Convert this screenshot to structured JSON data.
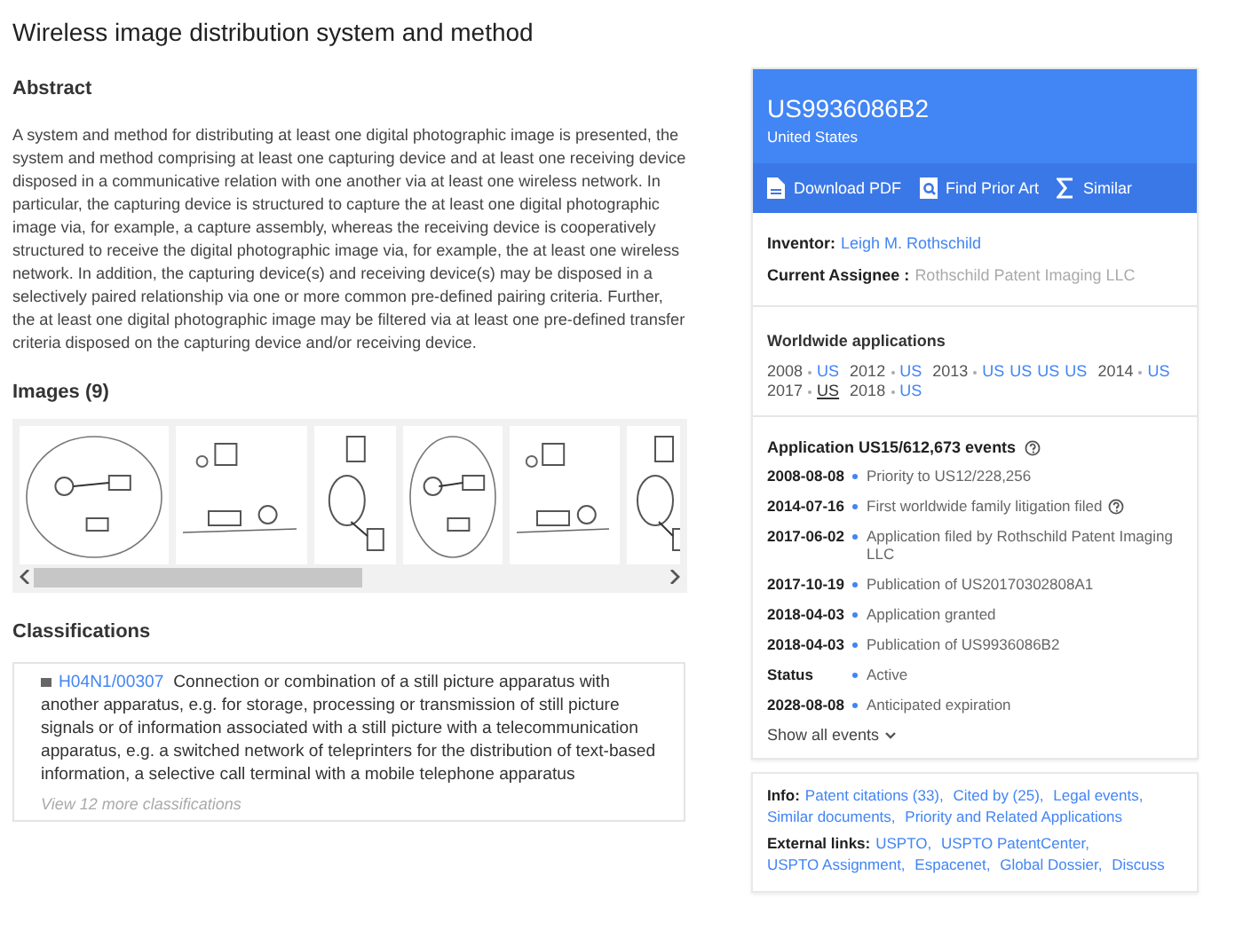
{
  "title": "Wireless image distribution system and method",
  "abstract": {
    "heading": "Abstract",
    "text": "A system and method for distributing at least one digital photographic image is presented, the system and method comprising at least one capturing device and at least one receiving device disposed in a communicative relation with one another via at least one wireless network. In particular, the capturing device is structured to capture the at least one digital photographic image via, for example, a capture assembly, whereas the receiving device is cooperatively structured to receive the digital photographic image via, for example, the at least one wireless network. In addition, the capturing device(s) and receiving device(s) may be disposed in a selectively paired relationship via one or more common pre-defined pairing criteria. Further, the at least one digital photographic image may be filtered via at least one pre-defined transfer criteria disposed on the capturing device and/or receiving device."
  },
  "images": {
    "heading": "Images (9)"
  },
  "classifications": {
    "heading": "Classifications",
    "code": "H04N1/00307",
    "description": "Connection or combination of a still picture apparatus with another apparatus, e.g. for storage, processing or transmission of still picture signals or of information associated with a still picture with a telecommunication apparatus, e.g. a switched network of teleprinters for the distribution of text-based information, a selective call terminal with a mobile telephone apparatus",
    "more": "View 12 more classifications"
  },
  "patent": {
    "number": "US9936086B2",
    "country": "United States",
    "actions": [
      {
        "kind": "pdf",
        "label": "Download PDF"
      },
      {
        "kind": "prior-art",
        "label": "Find Prior Art"
      },
      {
        "kind": "similar",
        "label": "Similar"
      }
    ],
    "inventor_label": "Inventor:",
    "inventor": "Leigh M. Rothschild",
    "assignee_label": "Current Assignee :",
    "assignee": "Rothschild Patent Imaging LLC"
  },
  "worldwide": {
    "heading": "Worldwide applications",
    "years": [
      {
        "year": "2008",
        "apps": [
          {
            "code": "US",
            "current": false
          }
        ]
      },
      {
        "year": "2012",
        "apps": [
          {
            "code": "US",
            "current": false
          }
        ]
      },
      {
        "year": "2013",
        "apps": [
          {
            "code": "US",
            "current": false
          },
          {
            "code": "US",
            "current": false
          },
          {
            "code": "US",
            "current": false
          },
          {
            "code": "US",
            "current": false
          }
        ]
      },
      {
        "year": "2014",
        "apps": [
          {
            "code": "US",
            "current": false
          }
        ]
      },
      {
        "year": "2017",
        "apps": [
          {
            "code": "US",
            "current": true
          }
        ]
      },
      {
        "year": "2018",
        "apps": [
          {
            "code": "US",
            "current": false
          }
        ]
      }
    ]
  },
  "events": {
    "heading": "Application US15/612,673 events",
    "items": [
      {
        "date": "2008-08-08",
        "text": "Priority to US12/228,256",
        "help": false
      },
      {
        "date": "2014-07-16",
        "text": "First worldwide family litigation filed",
        "help": true
      },
      {
        "date": "2017-06-02",
        "text": "Application filed by Rothschild Patent Imaging LLC",
        "help": false
      },
      {
        "date": "2017-10-19",
        "text": "Publication of US20170302808A1",
        "help": false
      },
      {
        "date": "2018-04-03",
        "text": "Application granted",
        "help": false
      },
      {
        "date": "2018-04-03",
        "text": "Publication of US9936086B2",
        "help": false
      },
      {
        "date": "Status",
        "text": "Active",
        "help": false
      },
      {
        "date": "2028-08-08",
        "text": "Anticipated expiration",
        "help": false
      }
    ],
    "show_all": "Show all events"
  },
  "info": {
    "label": "Info:",
    "links": [
      "Patent citations (33),",
      "Cited by (25),",
      "Legal events,",
      "Similar documents,",
      "Priority and Related Applications"
    ]
  },
  "external": {
    "label": "External links:",
    "links": [
      "USPTO,",
      "USPTO PatentCenter,",
      "USPTO Assignment,",
      "Espacenet,",
      "Global Dossier,",
      "Discuss"
    ]
  }
}
